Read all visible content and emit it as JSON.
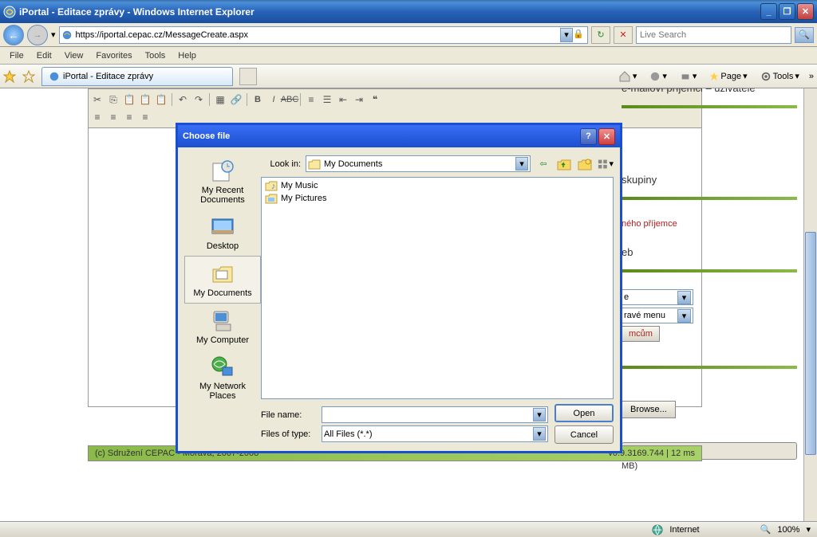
{
  "window": {
    "title": "iPortal - Editace zprávy - Windows Internet Explorer"
  },
  "nav": {
    "url": "https://iportal.cepac.cz/MessageCreate.aspx",
    "search_placeholder": "Live Search"
  },
  "menu": {
    "file": "File",
    "edit": "Edit",
    "view": "View",
    "favorites": "Favorites",
    "tools": "Tools",
    "help": "Help"
  },
  "cmdbar": {
    "tab_title": "iPortal - Editace zprávy",
    "page": "Page",
    "tools": "Tools"
  },
  "right_panel": {
    "h1": "e-mailoví příjemci – uživatelé",
    "h2": "skupiny",
    "link_add": "ného příjemce",
    "h3": "eb",
    "sel1": "e",
    "sel2": "ravé menu",
    "btn_recip": "mcům",
    "browse": "Browse...",
    "mb": "MB)"
  },
  "footer": {
    "left": "(c) Sdružení CEPAC - Morava, 2007-2008",
    "right": "v0.9.3169.744 | 12 ms"
  },
  "dialog": {
    "title": "Choose file",
    "look_in_label": "Look in:",
    "look_in_value": "My Documents",
    "places": {
      "recent": "My Recent Documents",
      "desktop": "Desktop",
      "docs": "My Documents",
      "computer": "My Computer",
      "network": "My Network Places"
    },
    "files": {
      "music": "My Music",
      "pictures": "My Pictures"
    },
    "file_name_label": "File name:",
    "file_name_value": "",
    "file_type_label": "Files of type:",
    "file_type_value": "All Files (*.*)",
    "open": "Open",
    "cancel": "Cancel"
  },
  "status": {
    "zone": "Internet",
    "zoom": "100%"
  }
}
